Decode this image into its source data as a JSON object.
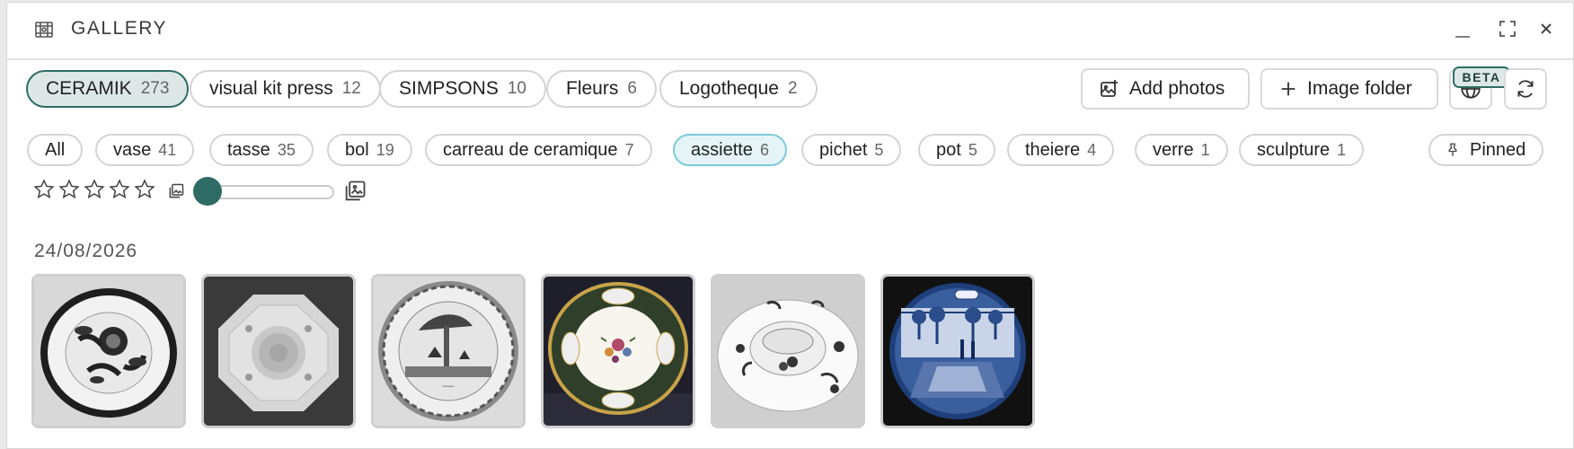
{
  "window": {
    "title": "GALLERY"
  },
  "albums": [
    {
      "name": "CERAMIK",
      "count": "273",
      "active": true
    },
    {
      "name": "visual kit press",
      "count": "12"
    },
    {
      "name": "SIMPSONS",
      "count": "10"
    },
    {
      "name": "Fleurs",
      "count": "6"
    },
    {
      "name": "Logotheque",
      "count": "2"
    }
  ],
  "actions": {
    "add_photos": "Add photos",
    "image_folder": "Image folder",
    "beta_badge": "BETA"
  },
  "tags": [
    {
      "name": "All",
      "count": ""
    },
    {
      "name": "vase",
      "count": "41"
    },
    {
      "name": "tasse",
      "count": "35"
    },
    {
      "name": "bol",
      "count": "19"
    },
    {
      "name": "carreau de ceramique",
      "count": "7"
    },
    {
      "name": "assiette",
      "count": "6",
      "active": true
    },
    {
      "name": "pichet",
      "count": "5"
    },
    {
      "name": "pot",
      "count": "5"
    },
    {
      "name": "theiere",
      "count": "4"
    },
    {
      "name": "verre",
      "count": "1"
    },
    {
      "name": "sculpture",
      "count": "1"
    }
  ],
  "pinned_label": "Pinned",
  "rating": {
    "stars": 5,
    "selected": 0
  },
  "thumbnail_size": {
    "value": 0
  },
  "gallery": {
    "date": "24/08/2026",
    "items": [
      {
        "subject": "black and white plate with floral design"
      },
      {
        "subject": "octagonal white plate on dark background"
      },
      {
        "subject": "plate with engraved landscape scene"
      },
      {
        "subject": "plate with green border and flower bouquet"
      },
      {
        "subject": "white plate with painted flowers"
      },
      {
        "subject": "blue and white delft plate with garden scene"
      }
    ]
  },
  "colors": {
    "accent": "#2f6c66",
    "accent_light": "#dde8e6",
    "tag_active": "#e4f4f7"
  }
}
